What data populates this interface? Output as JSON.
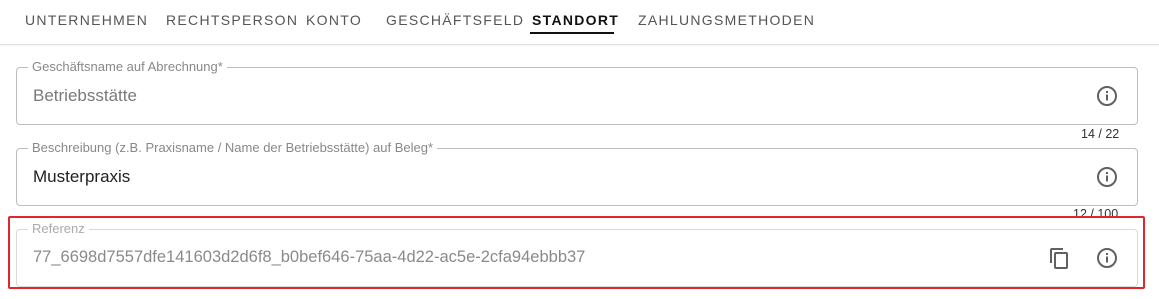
{
  "tabs": [
    {
      "label": "UNTERNEHMEN"
    },
    {
      "label": "RECHTSPERSON"
    },
    {
      "label": "KONTO"
    },
    {
      "label": "GESCHÄFTSFELD"
    },
    {
      "label": "STANDORT"
    },
    {
      "label": "ZAHLUNGSMETHODEN"
    }
  ],
  "active_tab": "STANDORT",
  "fields": {
    "business_name": {
      "label": "Geschäftsname auf Abrechnung*",
      "value": "Betriebsstätte",
      "counter": "14 / 22",
      "icon": "info-icon"
    },
    "description": {
      "label": "Beschreibung (z.B. Praxisname / Name der Betriebsstätte) auf Beleg*",
      "value": "Musterpraxis",
      "counter": "12 / 100",
      "icon": "info-icon"
    },
    "reference": {
      "label": "Referenz",
      "value": "77_6698d7557dfe141603d2d6f8_b0bef646-75aa-4d22-ac5e-2cfa94ebbb37",
      "icons": [
        "copy-icon",
        "info-icon"
      ]
    }
  },
  "colors": {
    "highlight": "#e2262b",
    "border": "#bdbdbd",
    "icon": "#616161"
  }
}
